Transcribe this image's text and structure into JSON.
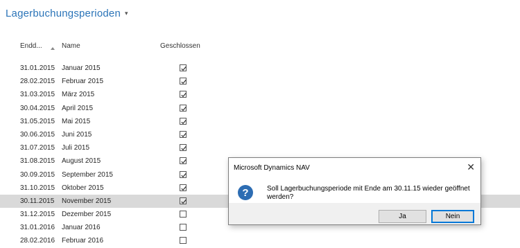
{
  "page": {
    "title": "Lagerbuchungsperioden",
    "title_caret": "▾"
  },
  "columns": {
    "end_date": "Endd...",
    "name": "Name",
    "closed": "Geschlossen"
  },
  "rows": [
    {
      "date": "31.01.2015",
      "name": "Januar 2015",
      "closed": true
    },
    {
      "date": "28.02.2015",
      "name": "Februar 2015",
      "closed": true
    },
    {
      "date": "31.03.2015",
      "name": "März 2015",
      "closed": true
    },
    {
      "date": "30.04.2015",
      "name": "April 2015",
      "closed": true
    },
    {
      "date": "31.05.2015",
      "name": "Mai 2015",
      "closed": true
    },
    {
      "date": "30.06.2015",
      "name": "Juni 2015",
      "closed": true
    },
    {
      "date": "31.07.2015",
      "name": "Juli 2015",
      "closed": true
    },
    {
      "date": "31.08.2015",
      "name": "August 2015",
      "closed": true
    },
    {
      "date": "30.09.2015",
      "name": "September 2015",
      "closed": true
    },
    {
      "date": "31.10.2015",
      "name": "Oktober 2015",
      "closed": true
    },
    {
      "date": "30.11.2015",
      "name": "November 2015",
      "closed": true,
      "selected": true
    },
    {
      "date": "31.12.2015",
      "name": "Dezember 2015",
      "closed": false
    },
    {
      "date": "31.01.2016",
      "name": "Januar 2016",
      "closed": false
    },
    {
      "date": "28.02.2016",
      "name": "Februar 2016",
      "closed": false
    }
  ],
  "dialog": {
    "title": "Microsoft Dynamics NAV",
    "close_glyph": "✕",
    "icon": "question-icon",
    "icon_glyph": "?",
    "message": "Soll Lagerbuchungsperiode mit Ende am 30.11.15 wieder geöffnet werden?",
    "yes_label": "Ja",
    "no_label": "Nein"
  }
}
